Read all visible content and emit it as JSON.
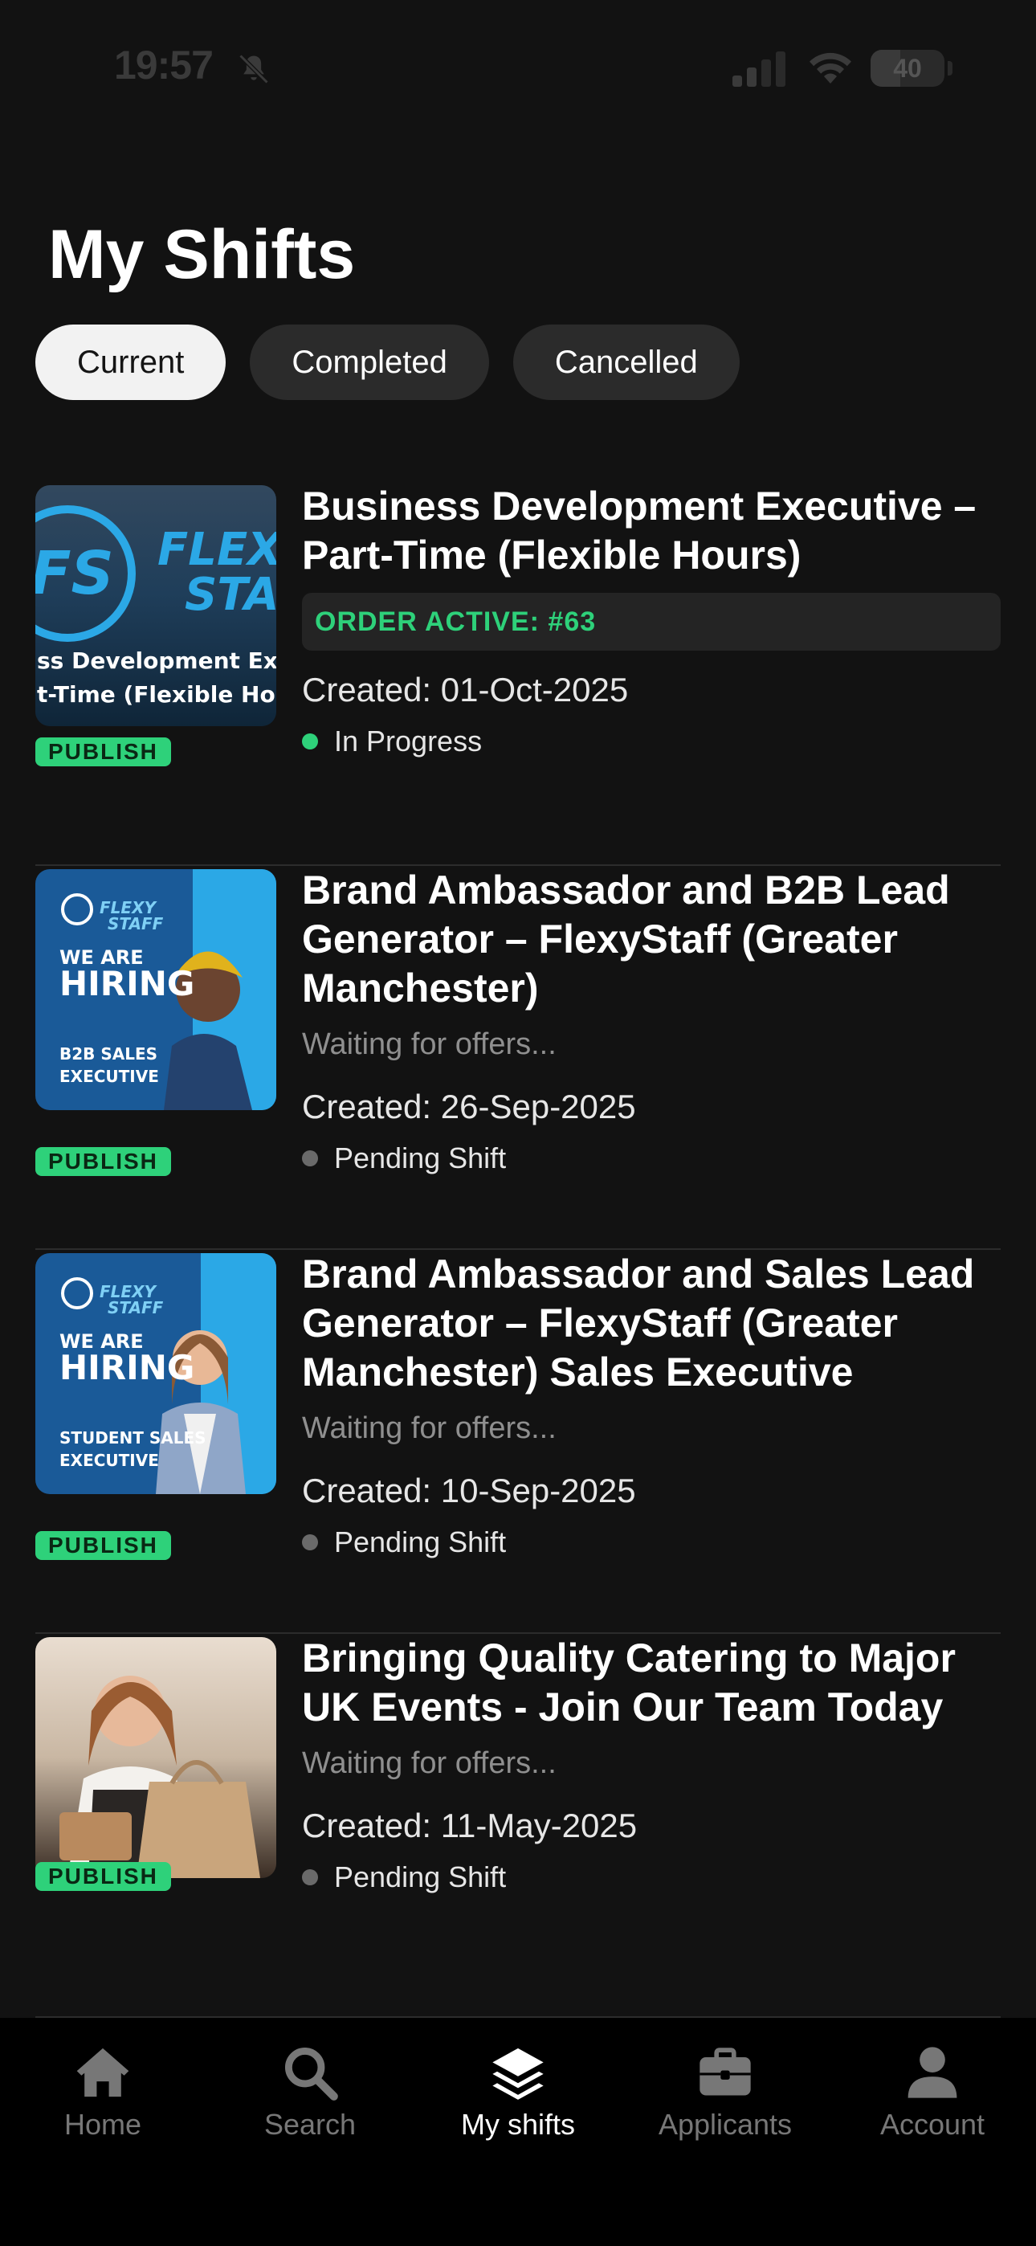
{
  "status_bar": {
    "time": "19:57",
    "battery": "40",
    "battery_level": 0.4
  },
  "page_title": "My Shifts",
  "tabs": [
    {
      "label": "Current",
      "active": true
    },
    {
      "label": "Completed",
      "active": false
    },
    {
      "label": "Cancelled",
      "active": false
    }
  ],
  "shifts": [
    {
      "title": "Business Development Executive – Part-Time (Flexible Hours)",
      "order": "ORDER ACTIVE: #63",
      "created": "Created: 01-Oct-2025",
      "status": "In Progress",
      "status_color": "#2ed17a",
      "badge": "PUBLISH",
      "thumb_lines": [
        "FLEXY",
        "STAFF",
        "ss Development Exe",
        "t-Time (Flexible Hou"
      ]
    },
    {
      "title": "Brand Ambassador and B2B Lead Generator – FlexyStaff (Greater Manchester)",
      "waiting": "Waiting for offers...",
      "created": "Created: 26-Sep-2025",
      "status": "Pending Shift",
      "status_color": "#6a6a6a",
      "badge": "PUBLISH",
      "thumb_lines": [
        "FLEXY",
        "STAFF",
        "WE ARE",
        "HIRING",
        "B2B SALES",
        "EXECUTIVE"
      ]
    },
    {
      "title": "Brand Ambassador and Sales Lead Generator – FlexyStaff (Greater Manchester) Sales Executive",
      "waiting": "Waiting for offers...",
      "created": "Created: 10-Sep-2025",
      "status": "Pending Shift",
      "status_color": "#6a6a6a",
      "badge": "PUBLISH",
      "thumb_lines": [
        "FLEXY",
        "STAFF",
        "WE ARE",
        "HIRING",
        "STUDENT SALES",
        "EXECUTIVE"
      ]
    },
    {
      "title": "Bringing Quality Catering to Major UK Events - Join Our Team Today",
      "waiting": "Waiting for offers...",
      "created": "Created: 11-May-2025",
      "status": "Pending Shift",
      "status_color": "#6a6a6a",
      "badge": "PUBLISH"
    }
  ],
  "bottom_nav": [
    {
      "label": "Home",
      "icon": "home-icon",
      "active": false
    },
    {
      "label": "Search",
      "icon": "search-icon",
      "active": false
    },
    {
      "label": "My shifts",
      "icon": "layers-icon",
      "active": true
    },
    {
      "label": "Applicants",
      "icon": "briefcase-icon",
      "active": false
    },
    {
      "label": "Account",
      "icon": "person-icon",
      "active": false
    }
  ],
  "colors": {
    "accent": "#2ed17a",
    "background": "#121212",
    "nav_background": "#000000"
  }
}
